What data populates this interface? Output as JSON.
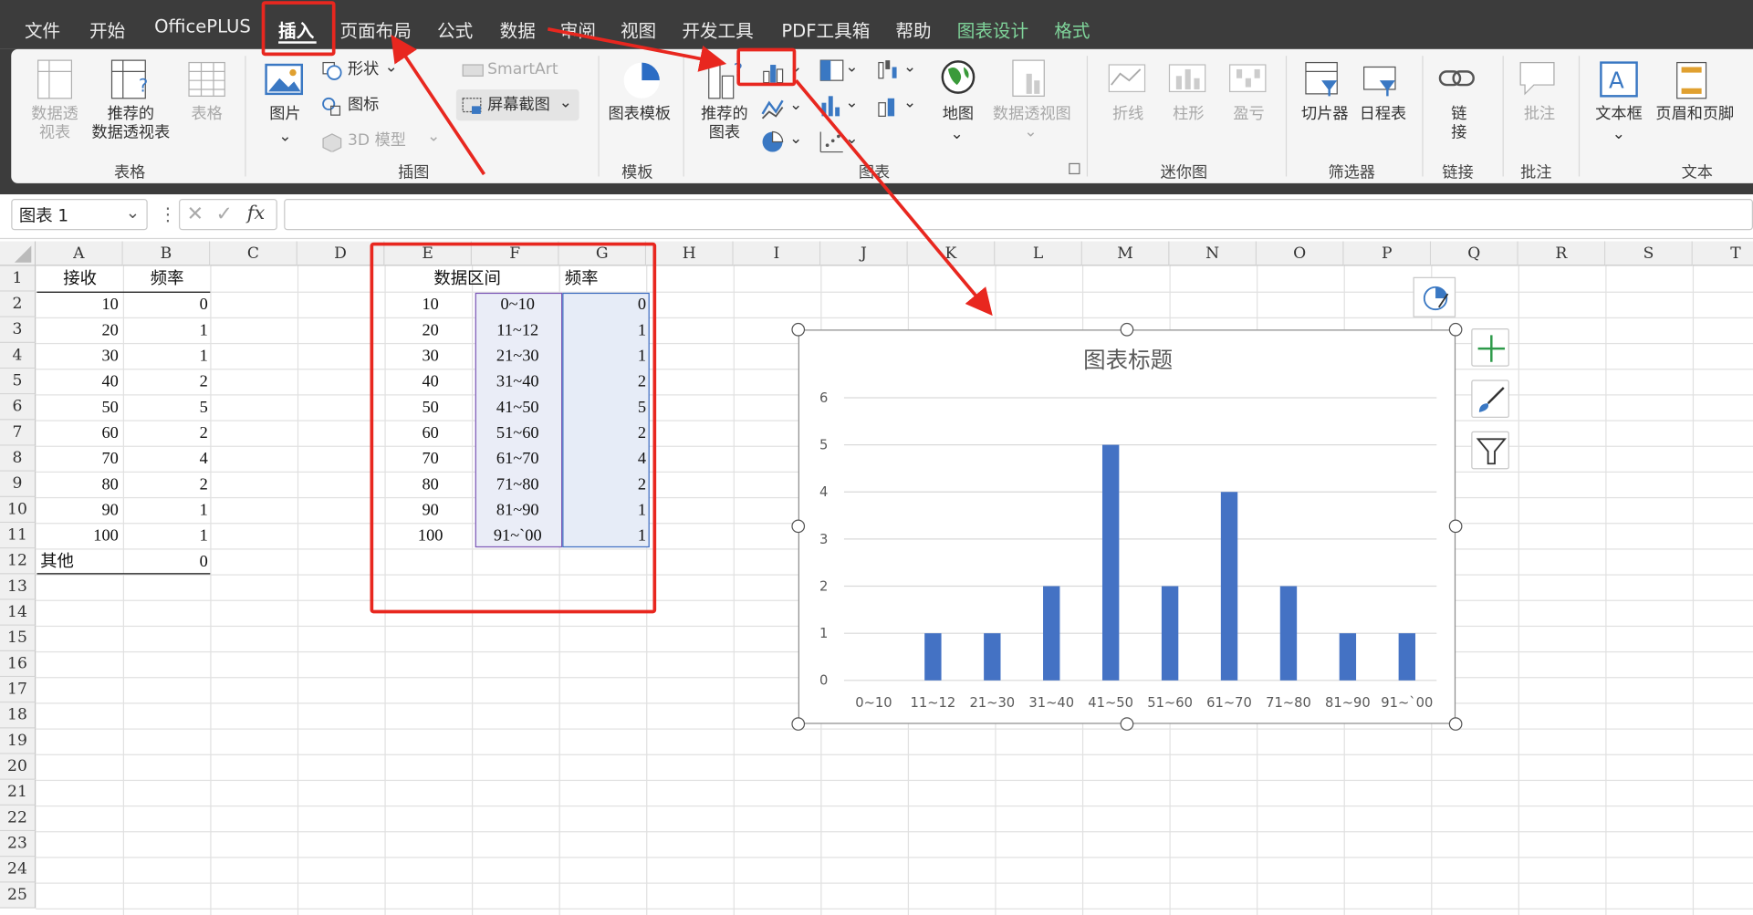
{
  "menu": {
    "tabs": [
      "文件",
      "开始",
      "OfficePLUS",
      "插入",
      "页面布局",
      "公式",
      "数据",
      "审阅",
      "视图",
      "开发工具",
      "PDF工具箱",
      "帮助",
      "图表设计",
      "格式"
    ]
  },
  "ribbon": {
    "table": {
      "pivot": "数据透\n视表",
      "recommended_pivot": "推荐的\n数据透视表",
      "table": "表格",
      "label": "表格"
    },
    "illustrations": {
      "picture": "图片",
      "shapes": "形状",
      "icons": "图标",
      "model3d": "3D 模型",
      "smartart": "SmartArt",
      "screenshot": "屏幕截图",
      "label": "插图"
    },
    "templates": {
      "chart_template": "图表模板",
      "label": "模板"
    },
    "charts": {
      "recommended": "推荐的\n图表",
      "map": "地图",
      "pivot_chart": "数据透视图",
      "label": "图表"
    },
    "sparklines": {
      "line": "折线",
      "column": "柱形",
      "winloss": "盈亏",
      "label": "迷你图"
    },
    "filters": {
      "slicer": "切片器",
      "timeline": "日程表",
      "label": "筛选器"
    },
    "links": {
      "link": "链\n接",
      "label": "链接"
    },
    "comments": {
      "comment": "批注",
      "label": "批注"
    },
    "text": {
      "textbox": "文本框",
      "header_footer": "页眉和页脚",
      "label": "文本"
    }
  },
  "formula_bar": {
    "name_box": "图表 1",
    "fx": "fx",
    "value": ""
  },
  "columns": [
    "A",
    "B",
    "C",
    "D",
    "E",
    "F",
    "G",
    "H",
    "I",
    "J",
    "K",
    "L",
    "M",
    "N",
    "O",
    "P",
    "Q",
    "R",
    "S",
    "T"
  ],
  "rows": [
    "1",
    "2",
    "3",
    "4",
    "5",
    "6",
    "7",
    "8",
    "9",
    "10",
    "11",
    "12",
    "13",
    "14",
    "15",
    "16",
    "17",
    "18",
    "19",
    "20",
    "21",
    "22",
    "23",
    "24",
    "25"
  ],
  "sheet": {
    "a_header": "接收",
    "b_header": "频率",
    "a_values": [
      "10",
      "20",
      "30",
      "40",
      "50",
      "60",
      "70",
      "80",
      "90",
      "100",
      "其他"
    ],
    "b_values": [
      "0",
      "1",
      "1",
      "2",
      "5",
      "2",
      "4",
      "2",
      "1",
      "1",
      "0"
    ],
    "e_header": "数据区间",
    "g_header": "频率",
    "e_values": [
      "10",
      "20",
      "30",
      "40",
      "50",
      "60",
      "70",
      "80",
      "90",
      "100"
    ],
    "f_values": [
      "0~10",
      "11~12",
      "21~30",
      "31~40",
      "41~50",
      "51~60",
      "61~70",
      "71~80",
      "81~90",
      "91~`00"
    ],
    "g_values": [
      "0",
      "1",
      "1",
      "2",
      "5",
      "2",
      "4",
      "2",
      "1",
      "1"
    ]
  },
  "colors": {
    "bar": "#4472c4",
    "annotation": "#e8271f",
    "menubar": "#3c3c3c"
  },
  "chart_data": {
    "type": "bar",
    "title": "图表标题",
    "categories": [
      "0~10",
      "11~12",
      "21~30",
      "31~40",
      "41~50",
      "51~60",
      "61~70",
      "71~80",
      "81~90",
      "91~`00"
    ],
    "values": [
      0,
      1,
      1,
      2,
      5,
      2,
      4,
      2,
      1,
      1
    ],
    "ylim": [
      0,
      6
    ],
    "yticks": [
      "0",
      "1",
      "2",
      "3",
      "4",
      "5",
      "6"
    ],
    "grid": true
  }
}
